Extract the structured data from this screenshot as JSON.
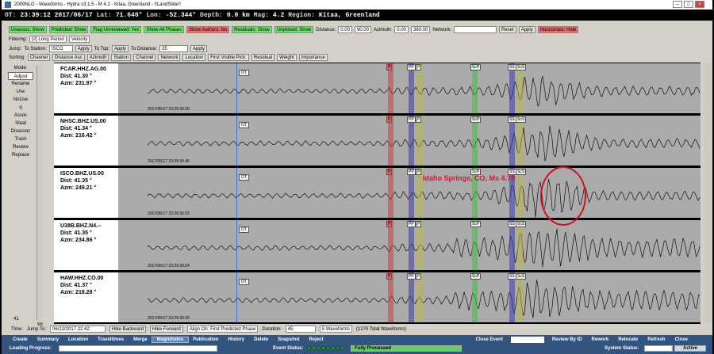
{
  "window": {
    "title": "2009NLG - Waveforms - Hydra v3.1.5 - M 4.2 - Kitaa, Greenland - !!LandSlide!!"
  },
  "event": {
    "ot_label": "OT:",
    "ot": "23:39:12 2017/06/17",
    "lat_label": "Lat:",
    "lat": "71.640°",
    "lon_label": "Lon:",
    "lon": "-52.344°",
    "depth_label": "Depth:",
    "depth": "0.0 km",
    "mag_label": "Mag:",
    "mag": "4.2",
    "region_label": "Region:",
    "region": "Kitaa, Greenland"
  },
  "filters": {
    "unassoc": "Unassoc: Show",
    "predicted": "Predicted: Show",
    "flag": "Flag Unreviewed: Yes",
    "phases": "Show All Phases",
    "authors": "Show Authors: No",
    "residuals": "Residuals: Show",
    "unpicked": "Unpicked: Show",
    "distance_label": "Distance:",
    "dist_min": "0.00",
    "dist_max": "90.00",
    "azimuth_label": "Azimuth:",
    "az_min": "0.00",
    "az_max": "360.00",
    "network_label": "Network:",
    "reset": "Reset",
    "apply": "Apply",
    "horizontals": "Horizontals: Hide"
  },
  "filtering": {
    "label": "Filtering:",
    "value": "[2] Long Period",
    "velocity": "Velocity"
  },
  "jump": {
    "label": "Jump:",
    "to_station": "To Station:",
    "station": "ISCO",
    "apply": "Apply",
    "to_top": "To Top:",
    "apply2": "Apply",
    "to_distance": "To Distance:",
    "distance": "35",
    "apply3": "Apply"
  },
  "sorting": {
    "label": "Sorting:",
    "options": [
      "Channel",
      "Distance Asc",
      "Azimuth",
      "Station",
      "Channel",
      "Network",
      "Location",
      "First Visible Pick:",
      "Residual",
      "Weight",
      "Importance"
    ]
  },
  "modes": [
    "Mode:",
    "Adjust",
    "Rename",
    "Use",
    "NoUse",
    "q",
    "Assoc",
    "Steal",
    "Disassoc",
    "Trash",
    "Review",
    "Replace"
  ],
  "page_number": "41",
  "ot_marker": "OT",
  "phase_labels": {
    "p": "P",
    "pp": "PP",
    "pp2": "P",
    "scp": "ScP",
    "ss": "SS",
    "scs": "ScS"
  },
  "traces": [
    {
      "name": "FCAR.HHZ.AG.00",
      "dist": "Dist: 41.30 °",
      "azm": "Azm: 231.97 °",
      "time": "2017/06/17 23:29:30.09"
    },
    {
      "name": "NHSC.BHZ.US.00",
      "dist": "Dist: 41.34 °",
      "azm": "Azm: 216.42 °",
      "time": "2017/06/17 23:29:30.45"
    },
    {
      "name": "ISCO.BHZ.US.00",
      "dist": "Dist: 41.35 °",
      "azm": "Azm: 249.21 °",
      "time": "2017/06/17 23:29:30.52"
    },
    {
      "name": "U38B.BHZ.N4.--",
      "dist": "Dist: 41.35 °",
      "azm": "Azm: 234.86 °",
      "time": "2017/06/17 23:29:30.54"
    },
    {
      "name": "HAW.HHZ.CO.00",
      "dist": "Dist: 41.37 °",
      "azm": "Azm: 218.28 °",
      "time": "2017/06/17 23:29:30.09"
    }
  ],
  "annotation": "Idaho Springs, CO, Ms 4.79",
  "timebar": {
    "label": "Time:",
    "jump_to": "Jump To:",
    "date": "06/22/2017 22:42:",
    "hike_backward": "Hike Backward",
    "hike_forward": "Hike Forward",
    "align": "Align On: First Predicted Phase",
    "duration_label": "Duration:",
    "duration": "45",
    "waveforms": "5 Waveforms",
    "total": "(1270 Total Waveforms)"
  },
  "menu": {
    "left": [
      "Create",
      "Summary",
      "Location",
      "Traveltimes",
      "Merge",
      "Magnitudes",
      "Publication",
      "History",
      "Delete",
      "Snapshot",
      "Reject"
    ],
    "active": "Magnitudes",
    "right": [
      "Close Event",
      "Review By ID",
      "Rework",
      "Relocate",
      "Refresh",
      "Close"
    ]
  },
  "status": {
    "loading": "Loading Progress:",
    "event_status": "Event Status:",
    "processed": "Fully Processed",
    "system_status": "System Status:",
    "active": "Active"
  }
}
